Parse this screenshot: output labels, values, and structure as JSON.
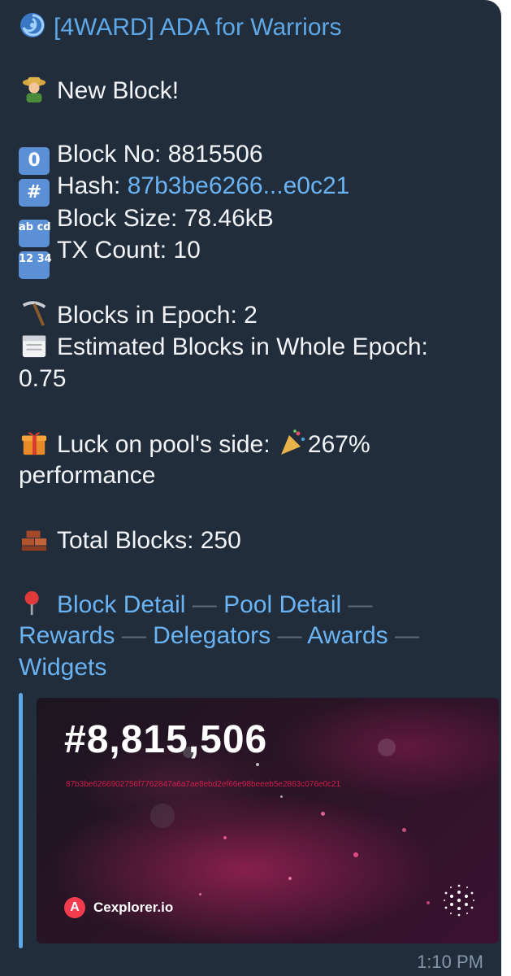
{
  "header": {
    "icon": "cyclone-icon",
    "title": "[4WARD] ADA for Warriors"
  },
  "message": {
    "intro": "New Block!",
    "block_no": "Block No: 8815506",
    "hash_label": "Hash: ",
    "hash_value": "87b3be6266...e0c21",
    "block_size": "Block Size: 78.46kB",
    "tx_count": "TX Count: 10",
    "blocks_in_epoch": "Blocks in Epoch: 2",
    "estimated_line1": "Estimated Blocks in Whole Epoch:",
    "estimated_line2": "0.75",
    "luck_label": "Luck on pool's side: ",
    "luck_value": "267%",
    "luck_line2": "performance",
    "total_blocks": "Total Blocks: 250"
  },
  "links": {
    "block_detail": "Block Detail",
    "pool_detail": "Pool Detail",
    "rewards": "Rewards",
    "delegators": "Delegators",
    "awards": "Awards",
    "widgets": "Widgets",
    "separator": "—"
  },
  "keycaps": {
    "zero": "0",
    "hash": "#",
    "abcd": "ab cd",
    "nums": "12 34"
  },
  "preview": {
    "block_number": "#8,815,506",
    "block_hash": "87b3be6266902756f7762847a6a7ae8ebd2ef66e98beeeb5e2863c076e0c21",
    "site_logo_letter": "A",
    "site_name": "Cexplorer.io"
  },
  "timestamp": "1:10 PM",
  "colors": {
    "bubble": "#212d3b",
    "link": "#6ab3f3",
    "title": "#5fa8e8",
    "hash_red": "#d01d48"
  }
}
